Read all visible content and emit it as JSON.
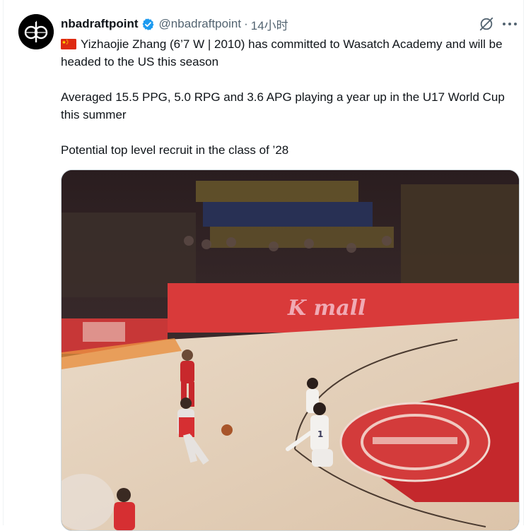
{
  "tweet": {
    "display_name": "nbadraftpoint",
    "handle": "@nbadraftpoint",
    "separator": "·",
    "timestamp": "14小时",
    "avatar_icon": "dp-logo-avatar",
    "verified_icon": "verified-badge-icon",
    "verified_color": "#1d9bf0",
    "paragraphs": [
      "Yizhaojie Zhang (6’7 W | 2010) has committed to Wasatch Academy and will be headed to the US this season",
      "Averaged 15.5 PPG, 5.0 RPG and 3.6 APG  playing a year up in the U17 World Cup this summer",
      "Potential top level recruit in the class of ’28"
    ],
    "flag_icon": "china-flag-icon",
    "media": {
      "type": "video",
      "description_icon": "basketball-video-thumbnail",
      "court_banner_text": "K mall",
      "player_jersey_number": "1"
    },
    "actions": {
      "grok_icon": "grok-icon",
      "more_icon": "more-horizontal-icon"
    }
  },
  "colors": {
    "text_primary": "#0f1419",
    "text_secondary": "#536471",
    "accent": "#1d9bf0",
    "border": "#cfd9de"
  }
}
